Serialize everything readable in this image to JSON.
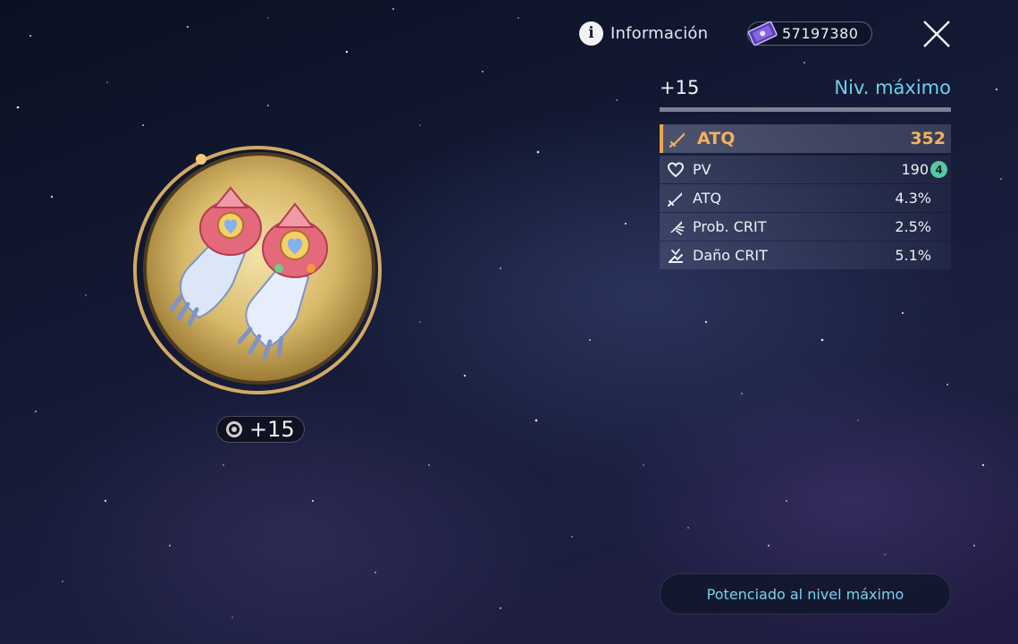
{
  "topbar": {
    "info_label": "Información",
    "currency_value": "57197380"
  },
  "relic": {
    "level_badge": "+15"
  },
  "panel": {
    "level": "+15",
    "max_label": "Niv. máximo",
    "main_stat": {
      "name": "ATQ",
      "value": "352",
      "icon": "sword-icon"
    },
    "sub_stats": [
      {
        "name": "PV",
        "value": "190",
        "roll": "4",
        "icon": "heart-icon"
      },
      {
        "name": "ATQ",
        "value": "4.3%",
        "icon": "sword-icon"
      },
      {
        "name": "Prob. CRIT",
        "value": "2.5%",
        "icon": "crit-rate-icon"
      },
      {
        "name": "Daño CRIT",
        "value": "5.1%",
        "icon": "crit-dmg-icon"
      }
    ]
  },
  "footer": {
    "button_label": "Potenciado al nivel máximo"
  },
  "colors": {
    "accent_gold": "#f3b25c",
    "accent_cyan": "#6ed1ec",
    "roll_green": "#57c9a2"
  }
}
